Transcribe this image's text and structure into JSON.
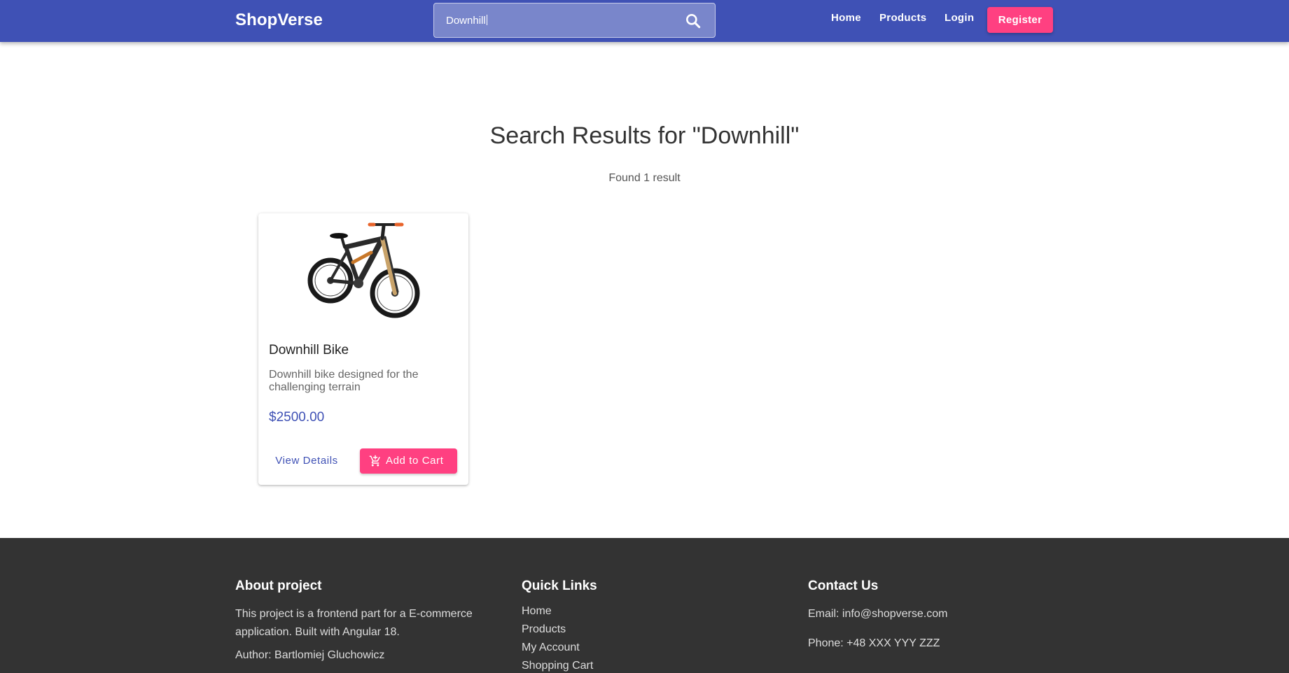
{
  "header": {
    "brand": "ShopVerse",
    "search": {
      "value": "Downhill",
      "icon": "search-icon"
    },
    "nav": {
      "home": "Home",
      "products": "Products",
      "login": "Login",
      "register": "Register"
    }
  },
  "results": {
    "title": "Search Results for \"Downhill\"",
    "count_text": "Found 1 result"
  },
  "product": {
    "name": "Downhill Bike",
    "description": "Downhill bike designed for the challenging terrain",
    "price": "$2500.00",
    "view_details_label": "View Details",
    "add_to_cart_label": "Add to Cart",
    "cart_icon": "add-shopping-cart-icon"
  },
  "footer": {
    "about": {
      "heading": "About project",
      "text": "This project is a frontend part for a E-commerce application. Built with Angular 18.",
      "author": "Author: Bartlomiej Gluchowicz"
    },
    "quick_links": {
      "heading": "Quick Links",
      "items": [
        "Home",
        "Products",
        "My Account",
        "Shopping Cart"
      ]
    },
    "contact": {
      "heading": "Contact Us",
      "email": "Email: info@shopverse.com",
      "phone": "Phone: +48 XXX YYY ZZZ"
    }
  },
  "colors": {
    "primary": "#3f51b5",
    "accent": "#ff4081",
    "search_bg": "#7986cb",
    "footer_bg": "#333333"
  }
}
